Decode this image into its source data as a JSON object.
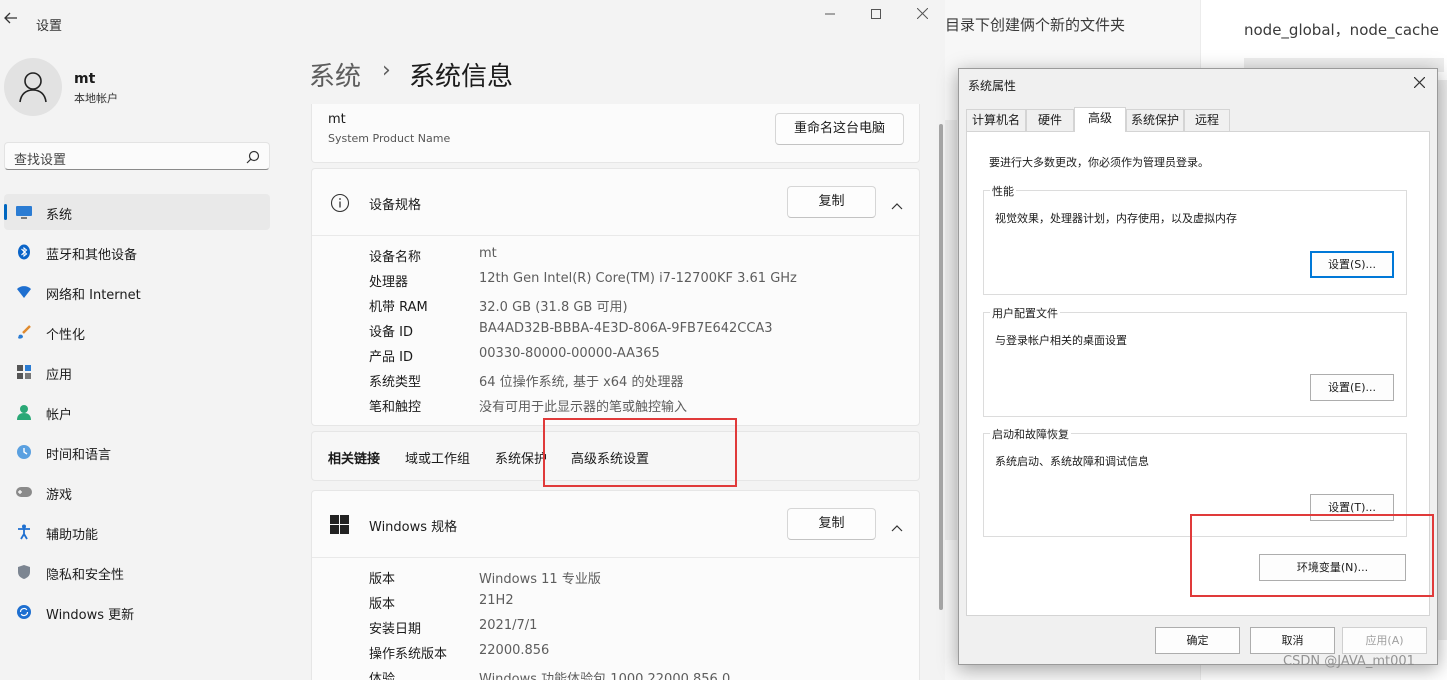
{
  "settings": {
    "app_title": "设置",
    "profile": {
      "name": "mt",
      "account_type": "本地帐户"
    },
    "search": {
      "placeholder": "查找设置"
    },
    "nav": [
      {
        "label": "系统",
        "icon": "monitor-icon",
        "active": true
      },
      {
        "label": "蓝牙和其他设备",
        "icon": "bluetooth-icon"
      },
      {
        "label": "网络和 Internet",
        "icon": "wifi-icon"
      },
      {
        "label": "个性化",
        "icon": "brush-icon"
      },
      {
        "label": "应用",
        "icon": "apps-icon"
      },
      {
        "label": "帐户",
        "icon": "person-icon"
      },
      {
        "label": "时间和语言",
        "icon": "clock-globe-icon"
      },
      {
        "label": "游戏",
        "icon": "gamepad-icon"
      },
      {
        "label": "辅助功能",
        "icon": "accessibility-icon"
      },
      {
        "label": "隐私和安全性",
        "icon": "shield-icon"
      },
      {
        "label": "Windows 更新",
        "icon": "update-icon"
      }
    ],
    "breadcrumb": {
      "parent": "系统",
      "separator": "›",
      "current": "系统信息"
    },
    "device_card": {
      "name": "mt",
      "model": "System Product Name",
      "rename_button": "重命名这台电脑"
    },
    "device_specs": {
      "title": "设备规格",
      "copy_button": "复制",
      "rows": [
        {
          "key": "设备名称",
          "value": "mt"
        },
        {
          "key": "处理器",
          "value": "12th Gen Intel(R) Core(TM) i7-12700KF   3.61 GHz"
        },
        {
          "key": "机带 RAM",
          "value": "32.0 GB (31.8 GB 可用)"
        },
        {
          "key": "设备 ID",
          "value": "BA4AD32B-BBBA-4E3D-806A-9FB7E642CCA3"
        },
        {
          "key": "产品 ID",
          "value": "00330-80000-00000-AA365"
        },
        {
          "key": "系统类型",
          "value": "64 位操作系统, 基于 x64 的处理器"
        },
        {
          "key": "笔和触控",
          "value": "没有可用于此显示器的笔或触控输入"
        }
      ]
    },
    "related_links": {
      "label": "相关链接",
      "links": [
        "域或工作组",
        "系统保护",
        "高级系统设置"
      ]
    },
    "windows_specs": {
      "title": "Windows 规格",
      "copy_button": "复制",
      "rows": [
        {
          "key": "版本",
          "value": "Windows 11 专业版"
        },
        {
          "key": "版本",
          "value": "21H2"
        },
        {
          "key": "安装日期",
          "value": "2021/7/1"
        },
        {
          "key": "操作系统版本",
          "value": "22000.856"
        },
        {
          "key": "体验",
          "value": "Windows 功能体验包 1000.22000.856.0"
        }
      ]
    }
  },
  "background": {
    "doc_text": "目录下创建俩个新的文件夹",
    "right_text": "node_global，node_cache"
  },
  "system_properties": {
    "title": "系统属性",
    "tabs": [
      "计算机名",
      "硬件",
      "高级",
      "系统保护",
      "远程"
    ],
    "active_tab": "高级",
    "admin_note": "要进行大多数更改，你必须作为管理员登录。",
    "groups": [
      {
        "title": "性能",
        "description": "视觉效果，处理器计划，内存使用，以及虚拟内存",
        "button": "设置(S)..."
      },
      {
        "title": "用户配置文件",
        "description": "与登录帐户相关的桌面设置",
        "button": "设置(E)..."
      },
      {
        "title": "启动和故障恢复",
        "description": "系统启动、系统故障和调试信息",
        "button": "设置(T)..."
      }
    ],
    "env_button": "环境变量(N)...",
    "footer": {
      "ok": "确定",
      "cancel": "取消",
      "apply": "应用(A)"
    }
  },
  "watermark": "CSDN @JAVA_mt001",
  "colors": {
    "accent": "#0067c0",
    "highlight_box": "#e03a3a"
  }
}
